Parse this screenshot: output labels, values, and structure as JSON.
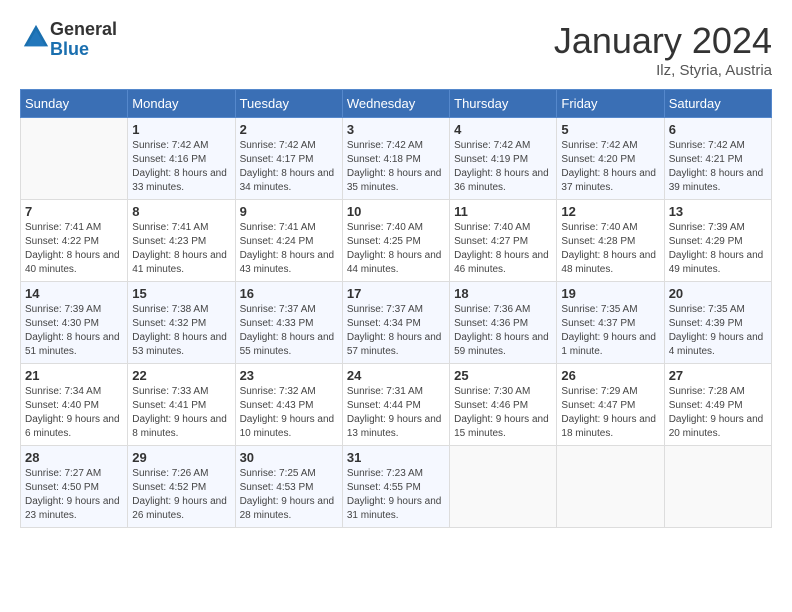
{
  "header": {
    "logo_line1": "General",
    "logo_line2": "Blue",
    "month_title": "January 2024",
    "subtitle": "Ilz, Styria, Austria"
  },
  "days_of_week": [
    "Sunday",
    "Monday",
    "Tuesday",
    "Wednesday",
    "Thursday",
    "Friday",
    "Saturday"
  ],
  "weeks": [
    [
      {
        "num": "",
        "sunrise": "",
        "sunset": "",
        "daylight": ""
      },
      {
        "num": "1",
        "sunrise": "Sunrise: 7:42 AM",
        "sunset": "Sunset: 4:16 PM",
        "daylight": "Daylight: 8 hours and 33 minutes."
      },
      {
        "num": "2",
        "sunrise": "Sunrise: 7:42 AM",
        "sunset": "Sunset: 4:17 PM",
        "daylight": "Daylight: 8 hours and 34 minutes."
      },
      {
        "num": "3",
        "sunrise": "Sunrise: 7:42 AM",
        "sunset": "Sunset: 4:18 PM",
        "daylight": "Daylight: 8 hours and 35 minutes."
      },
      {
        "num": "4",
        "sunrise": "Sunrise: 7:42 AM",
        "sunset": "Sunset: 4:19 PM",
        "daylight": "Daylight: 8 hours and 36 minutes."
      },
      {
        "num": "5",
        "sunrise": "Sunrise: 7:42 AM",
        "sunset": "Sunset: 4:20 PM",
        "daylight": "Daylight: 8 hours and 37 minutes."
      },
      {
        "num": "6",
        "sunrise": "Sunrise: 7:42 AM",
        "sunset": "Sunset: 4:21 PM",
        "daylight": "Daylight: 8 hours and 39 minutes."
      }
    ],
    [
      {
        "num": "7",
        "sunrise": "Sunrise: 7:41 AM",
        "sunset": "Sunset: 4:22 PM",
        "daylight": "Daylight: 8 hours and 40 minutes."
      },
      {
        "num": "8",
        "sunrise": "Sunrise: 7:41 AM",
        "sunset": "Sunset: 4:23 PM",
        "daylight": "Daylight: 8 hours and 41 minutes."
      },
      {
        "num": "9",
        "sunrise": "Sunrise: 7:41 AM",
        "sunset": "Sunset: 4:24 PM",
        "daylight": "Daylight: 8 hours and 43 minutes."
      },
      {
        "num": "10",
        "sunrise": "Sunrise: 7:40 AM",
        "sunset": "Sunset: 4:25 PM",
        "daylight": "Daylight: 8 hours and 44 minutes."
      },
      {
        "num": "11",
        "sunrise": "Sunrise: 7:40 AM",
        "sunset": "Sunset: 4:27 PM",
        "daylight": "Daylight: 8 hours and 46 minutes."
      },
      {
        "num": "12",
        "sunrise": "Sunrise: 7:40 AM",
        "sunset": "Sunset: 4:28 PM",
        "daylight": "Daylight: 8 hours and 48 minutes."
      },
      {
        "num": "13",
        "sunrise": "Sunrise: 7:39 AM",
        "sunset": "Sunset: 4:29 PM",
        "daylight": "Daylight: 8 hours and 49 minutes."
      }
    ],
    [
      {
        "num": "14",
        "sunrise": "Sunrise: 7:39 AM",
        "sunset": "Sunset: 4:30 PM",
        "daylight": "Daylight: 8 hours and 51 minutes."
      },
      {
        "num": "15",
        "sunrise": "Sunrise: 7:38 AM",
        "sunset": "Sunset: 4:32 PM",
        "daylight": "Daylight: 8 hours and 53 minutes."
      },
      {
        "num": "16",
        "sunrise": "Sunrise: 7:37 AM",
        "sunset": "Sunset: 4:33 PM",
        "daylight": "Daylight: 8 hours and 55 minutes."
      },
      {
        "num": "17",
        "sunrise": "Sunrise: 7:37 AM",
        "sunset": "Sunset: 4:34 PM",
        "daylight": "Daylight: 8 hours and 57 minutes."
      },
      {
        "num": "18",
        "sunrise": "Sunrise: 7:36 AM",
        "sunset": "Sunset: 4:36 PM",
        "daylight": "Daylight: 8 hours and 59 minutes."
      },
      {
        "num": "19",
        "sunrise": "Sunrise: 7:35 AM",
        "sunset": "Sunset: 4:37 PM",
        "daylight": "Daylight: 9 hours and 1 minute."
      },
      {
        "num": "20",
        "sunrise": "Sunrise: 7:35 AM",
        "sunset": "Sunset: 4:39 PM",
        "daylight": "Daylight: 9 hours and 4 minutes."
      }
    ],
    [
      {
        "num": "21",
        "sunrise": "Sunrise: 7:34 AM",
        "sunset": "Sunset: 4:40 PM",
        "daylight": "Daylight: 9 hours and 6 minutes."
      },
      {
        "num": "22",
        "sunrise": "Sunrise: 7:33 AM",
        "sunset": "Sunset: 4:41 PM",
        "daylight": "Daylight: 9 hours and 8 minutes."
      },
      {
        "num": "23",
        "sunrise": "Sunrise: 7:32 AM",
        "sunset": "Sunset: 4:43 PM",
        "daylight": "Daylight: 9 hours and 10 minutes."
      },
      {
        "num": "24",
        "sunrise": "Sunrise: 7:31 AM",
        "sunset": "Sunset: 4:44 PM",
        "daylight": "Daylight: 9 hours and 13 minutes."
      },
      {
        "num": "25",
        "sunrise": "Sunrise: 7:30 AM",
        "sunset": "Sunset: 4:46 PM",
        "daylight": "Daylight: 9 hours and 15 minutes."
      },
      {
        "num": "26",
        "sunrise": "Sunrise: 7:29 AM",
        "sunset": "Sunset: 4:47 PM",
        "daylight": "Daylight: 9 hours and 18 minutes."
      },
      {
        "num": "27",
        "sunrise": "Sunrise: 7:28 AM",
        "sunset": "Sunset: 4:49 PM",
        "daylight": "Daylight: 9 hours and 20 minutes."
      }
    ],
    [
      {
        "num": "28",
        "sunrise": "Sunrise: 7:27 AM",
        "sunset": "Sunset: 4:50 PM",
        "daylight": "Daylight: 9 hours and 23 minutes."
      },
      {
        "num": "29",
        "sunrise": "Sunrise: 7:26 AM",
        "sunset": "Sunset: 4:52 PM",
        "daylight": "Daylight: 9 hours and 26 minutes."
      },
      {
        "num": "30",
        "sunrise": "Sunrise: 7:25 AM",
        "sunset": "Sunset: 4:53 PM",
        "daylight": "Daylight: 9 hours and 28 minutes."
      },
      {
        "num": "31",
        "sunrise": "Sunrise: 7:23 AM",
        "sunset": "Sunset: 4:55 PM",
        "daylight": "Daylight: 9 hours and 31 minutes."
      },
      {
        "num": "",
        "sunrise": "",
        "sunset": "",
        "daylight": ""
      },
      {
        "num": "",
        "sunrise": "",
        "sunset": "",
        "daylight": ""
      },
      {
        "num": "",
        "sunrise": "",
        "sunset": "",
        "daylight": ""
      }
    ]
  ]
}
